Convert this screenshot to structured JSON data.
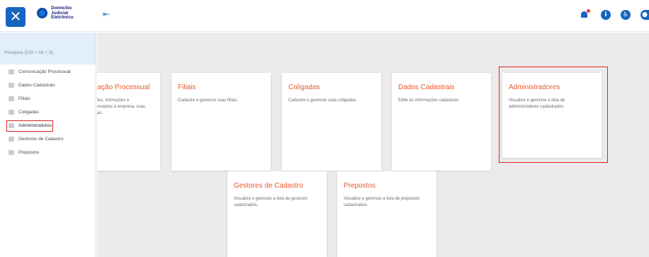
{
  "header": {
    "close_glyph": "✕",
    "logo_lines": [
      "Domicílio",
      "Judicial",
      "Eletrônico"
    ],
    "pin_glyph": "⇤",
    "icons": [
      "notification-bell-icon",
      "info-icon",
      "accessibility-icon",
      "user-icon"
    ],
    "info_glyph": "i",
    "accessibility_glyph": "♿",
    "user_glyph": "●"
  },
  "sidebar": {
    "search_placeholder": "Pesquisa (Ctrl + Alt + S)",
    "items": [
      {
        "label": "Comunicação Processual",
        "icon": "mail-icon"
      },
      {
        "label": "Dados Cadastrais",
        "icon": "document-icon"
      },
      {
        "label": "Filiais",
        "icon": "building-icon"
      },
      {
        "label": "Coligadas",
        "icon": "building-icon"
      },
      {
        "label": "Administradores",
        "icon": "people-icon"
      },
      {
        "label": "Gestores de Cadastro",
        "icon": "people-icon"
      },
      {
        "label": "Prepostos",
        "icon": "people-icon"
      }
    ],
    "active_index": 4
  },
  "cards": [
    {
      "title": "Comunicação Processual",
      "desc": "Consulte citações, intimações e comunicados enviados à empresa, suas filiais e coligadas."
    },
    {
      "title": "Filiais",
      "desc": "Cadastre e gerencie suas filiais."
    },
    {
      "title": "Coligadas",
      "desc": "Cadastre e gerencie suas coligadas."
    },
    {
      "title": "Dados Cadastrais",
      "desc": "Edite as informações cadastrais."
    },
    {
      "title": "Administradores",
      "desc": "Visualize e gerencie a lista de administradores cadastrados."
    },
    {
      "title": "Gestores de Cadastro",
      "desc": "Visualize e gerencie a lista de gestores cadastrados."
    },
    {
      "title": "Prepostos",
      "desc": "Visualize e gerencie a lista de prepostos cadastrados."
    }
  ],
  "colors": {
    "accent": "#1565c0",
    "card_title": "#e8592a",
    "highlight": "#e02020",
    "background": "#ecebea"
  }
}
